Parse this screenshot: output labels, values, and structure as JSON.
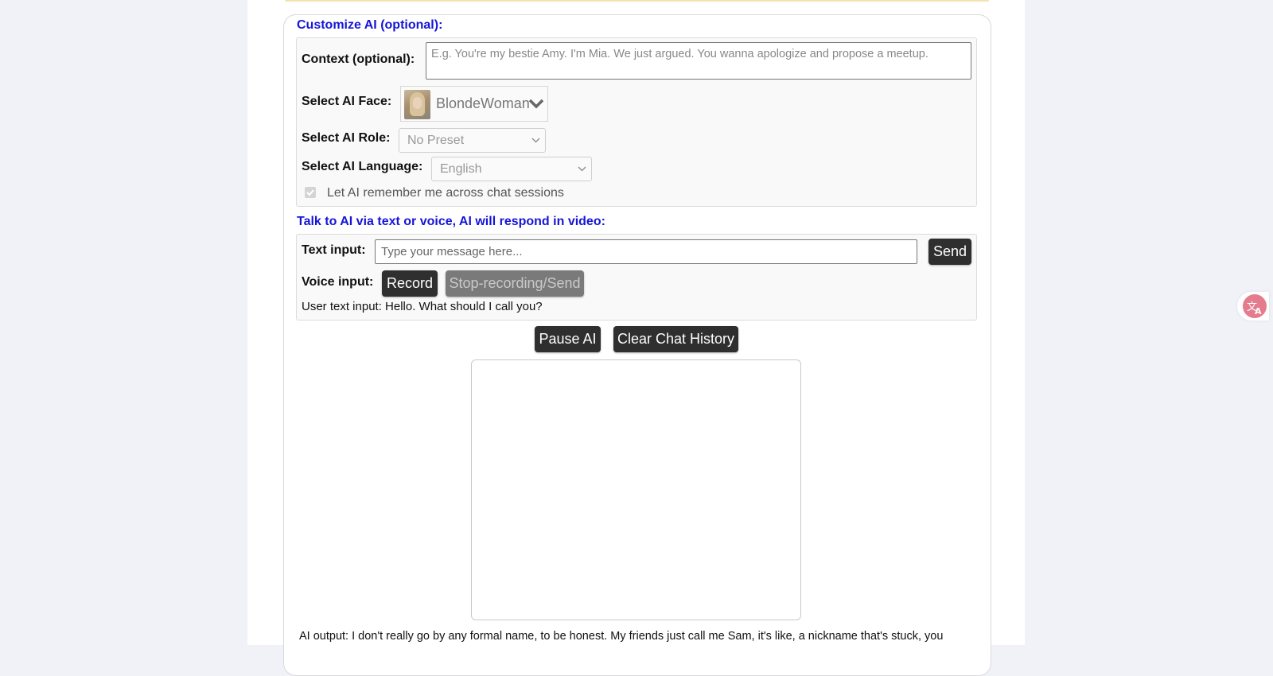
{
  "customize": {
    "title": "Customize AI (optional):",
    "context_label": "Context (optional):",
    "context_placeholder": "E.g. You're my bestie Amy. I'm Mia. We just argued. You wanna apologize and propose a meetup.",
    "face_label": "Select AI Face:",
    "face_value": "BlondeWoman",
    "role_label": "Select AI Role:",
    "role_value": "No Preset",
    "language_label": "Select AI Language:",
    "language_value": "English",
    "remember_label": "Let AI remember me across chat sessions",
    "remember_checked": true
  },
  "talk": {
    "title": "Talk to AI via text or voice, AI will respond in video:",
    "text_label": "Text input:",
    "text_placeholder": "Type your message here...",
    "send_label": "Send",
    "voice_label": "Voice input:",
    "record_label": "Record",
    "stop_label": "Stop-recording/Send",
    "user_text": "User text input: Hello. What should I call you?"
  },
  "controls": {
    "pause_label": "Pause AI",
    "clear_label": "Clear Chat History"
  },
  "output": {
    "ai_text": "AI output: I don't really go by any formal name, to be honest. My friends just call me Sam, it's like, a nickname that's stuck, you"
  },
  "colors": {
    "section_title": "#1515d8",
    "button_bg": "#2f2f2f",
    "page_bg": "#f1f2f8"
  },
  "icons": {
    "translate": "translate-icon",
    "chevron": "chevron-down-icon"
  }
}
